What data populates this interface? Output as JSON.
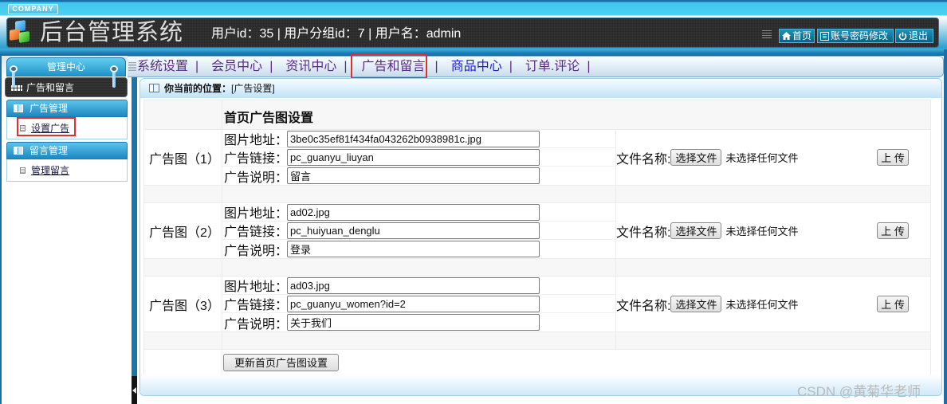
{
  "header": {
    "company": "COMPANY",
    "title": "后台管理系统",
    "user_info": "用户id：35 | 用户分组id：7 | 用户名：admin",
    "buttons": [
      {
        "label": "首页",
        "icon": "home-icon"
      },
      {
        "label": "账号密码修改",
        "icon": "list-icon"
      },
      {
        "label": "退出",
        "icon": "power-icon"
      }
    ]
  },
  "sidebar": {
    "panel_title": "管理中心",
    "section_title": "广告和留言",
    "groups": [
      {
        "title": "广告管理",
        "items": [
          {
            "label": "设置广告",
            "selected": true
          }
        ]
      },
      {
        "title": "留言管理",
        "items": [
          {
            "label": "管理留言",
            "selected": false
          }
        ]
      }
    ]
  },
  "nav": {
    "items": [
      {
        "label": "系统设置"
      },
      {
        "label": "会员中心"
      },
      {
        "label": "资讯中心"
      },
      {
        "label": "广告和留言",
        "active": true
      },
      {
        "label": "商品中心"
      },
      {
        "label": "订单.评论"
      }
    ],
    "separator": "|"
  },
  "breadcrumb": {
    "label": "你当前的位置：",
    "value": "[广告设置]"
  },
  "form": {
    "title": "首页广告图设置",
    "field_labels": {
      "image": "图片地址：",
      "link": "广告链接：",
      "desc": "广告说明："
    },
    "upload": {
      "label": "文件名称:",
      "choose": "选择文件",
      "no_file": "未选择任何文件",
      "upload": "上 传"
    },
    "ads": [
      {
        "label": "广告图（1）",
        "image": "3be0c35ef81f434fa043262b0938981c.jpg",
        "link": "pc_guanyu_liuyan",
        "desc": "留言"
      },
      {
        "label": "广告图（2）",
        "image": "ad02.jpg",
        "link": "pc_huiyuan_denglu",
        "desc": "登录"
      },
      {
        "label": "广告图（3）",
        "image": "ad03.jpg",
        "link": "pc_guanyu_women?id=2",
        "desc": "关于我们"
      }
    ],
    "submit": "更新首页广告图设置"
  },
  "watermark": "CSDN @黄菊华老师",
  "colors": {
    "header_dark": "#262626",
    "frame_blue": "#1c6ea8",
    "highlight_red": "#e0302c",
    "nav_visited": "#5b2a88",
    "nav_link": "#1d1dd8"
  }
}
